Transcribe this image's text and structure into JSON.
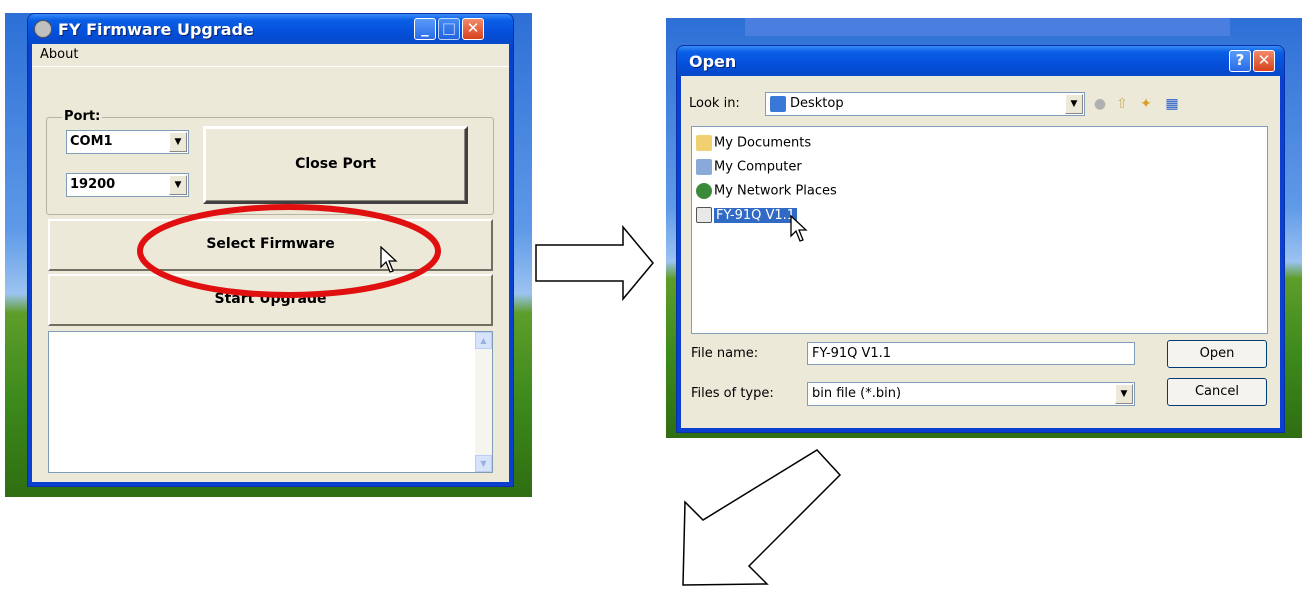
{
  "upgrade_window": {
    "title": "FY Firmware Upgrade",
    "menu_about": "About",
    "port_group_label": "Port:",
    "port_value": "COM1",
    "baud_value": "19200",
    "close_port_label": "Close Port",
    "select_firmware_label": "Select Firmware",
    "start_upgrade_label": "Start Upgrade",
    "minimize_glyph": "_",
    "maximize_glyph": "□",
    "close_glyph": "✕"
  },
  "open_dialog": {
    "title": "Open",
    "help_glyph": "?",
    "close_glyph": "✕",
    "look_in_label": "Look in:",
    "look_in_value": "Desktop",
    "files": [
      {
        "name": "My Documents",
        "icon": "folder-icon"
      },
      {
        "name": "My Computer",
        "icon": "computer-icon"
      },
      {
        "name": "My Network Places",
        "icon": "network-icon"
      },
      {
        "name": "FY-91Q V1.1",
        "icon": "bin-file-icon",
        "selected": true
      }
    ],
    "file_name_label": "File name:",
    "file_name_value": "FY-91Q V1.1",
    "files_of_type_label": "Files of type:",
    "files_of_type_value": "bin file (*.bin)",
    "open_button": "Open",
    "cancel_button": "Cancel"
  },
  "colors": {
    "highlight_ellipse": "#e01010",
    "xp_title_blue": "#0550db",
    "selection_blue": "#316ac5"
  }
}
